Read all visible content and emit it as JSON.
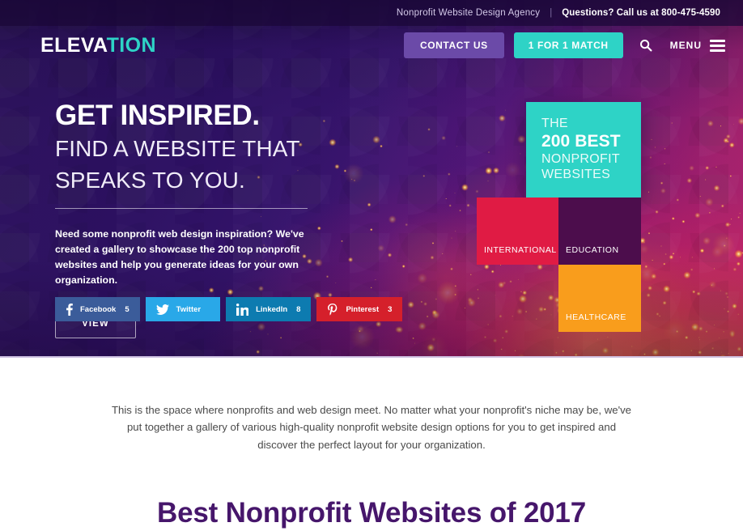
{
  "topbar": {
    "tagline": "Nonprofit Website Design Agency",
    "separator": "|",
    "phone": "Questions? Call us at 800-475-4590"
  },
  "nav": {
    "logo_white": "ELEVA",
    "logo_teal": "TION",
    "contact_label": "CONTACT US",
    "match_label": "1 FOR 1 MATCH",
    "menu_label": "MENU",
    "search_icon": "search-icon",
    "hamburger_icon": "hamburger-icon"
  },
  "hero": {
    "heading_main": "GET INSPIRED.",
    "heading_sub_line1": "FIND A WEBSITE THAT",
    "heading_sub_line2": "SPEAKS TO YOU.",
    "paragraph": "Need some nonprofit web design inspiration? We've created a gallery to showcase the 200 top nonprofit websites and help you generate ideas for your own organization.",
    "view_button": "VIEW"
  },
  "social": [
    {
      "network": "Facebook",
      "label": "Facebook",
      "count": "5",
      "icon": "facebook-icon",
      "glyph": "f",
      "color": "#3b5c9a"
    },
    {
      "network": "Twitter",
      "label": "Twitter",
      "count": "",
      "icon": "twitter-icon",
      "glyph": "ᵗ",
      "color": "#29a8e8"
    },
    {
      "network": "LinkedIn",
      "label": "LinkedIn",
      "count": "8",
      "icon": "linkedin-icon",
      "glyph": "in",
      "color": "#0d7bb0"
    },
    {
      "network": "Pinterest",
      "label": "Pinterest",
      "count": "3",
      "icon": "pinterest-icon",
      "glyph": "P",
      "color": "#d5202b"
    }
  ],
  "tiles": {
    "promo": {
      "line1": "THE",
      "line2": "200 BEST",
      "line3": "NONPROFIT",
      "line4": "WEBSITES",
      "color": "#2ed3c6"
    },
    "categories": [
      {
        "label": "INTERNATIONAL",
        "color": "#e01b44"
      },
      {
        "label": "EDUCATION",
        "color": "#4c0d4c"
      },
      {
        "label": "HEALTHCARE",
        "color": "#f99d1c"
      }
    ]
  },
  "below": {
    "intro": "This is the space where nonprofits and web design meet. No matter what your nonprofit's niche may be, we've put together a gallery of various high-quality nonprofit website design options for you to get inspired and discover the perfect layout for your organization.",
    "section_title": "Best Nonprofit Websites of 2017"
  },
  "colors": {
    "brand_teal": "#2ed3c6",
    "brand_purple": "#6b4aa8",
    "heading_purple": "#46166b",
    "hero_dark": "#2a1059"
  }
}
